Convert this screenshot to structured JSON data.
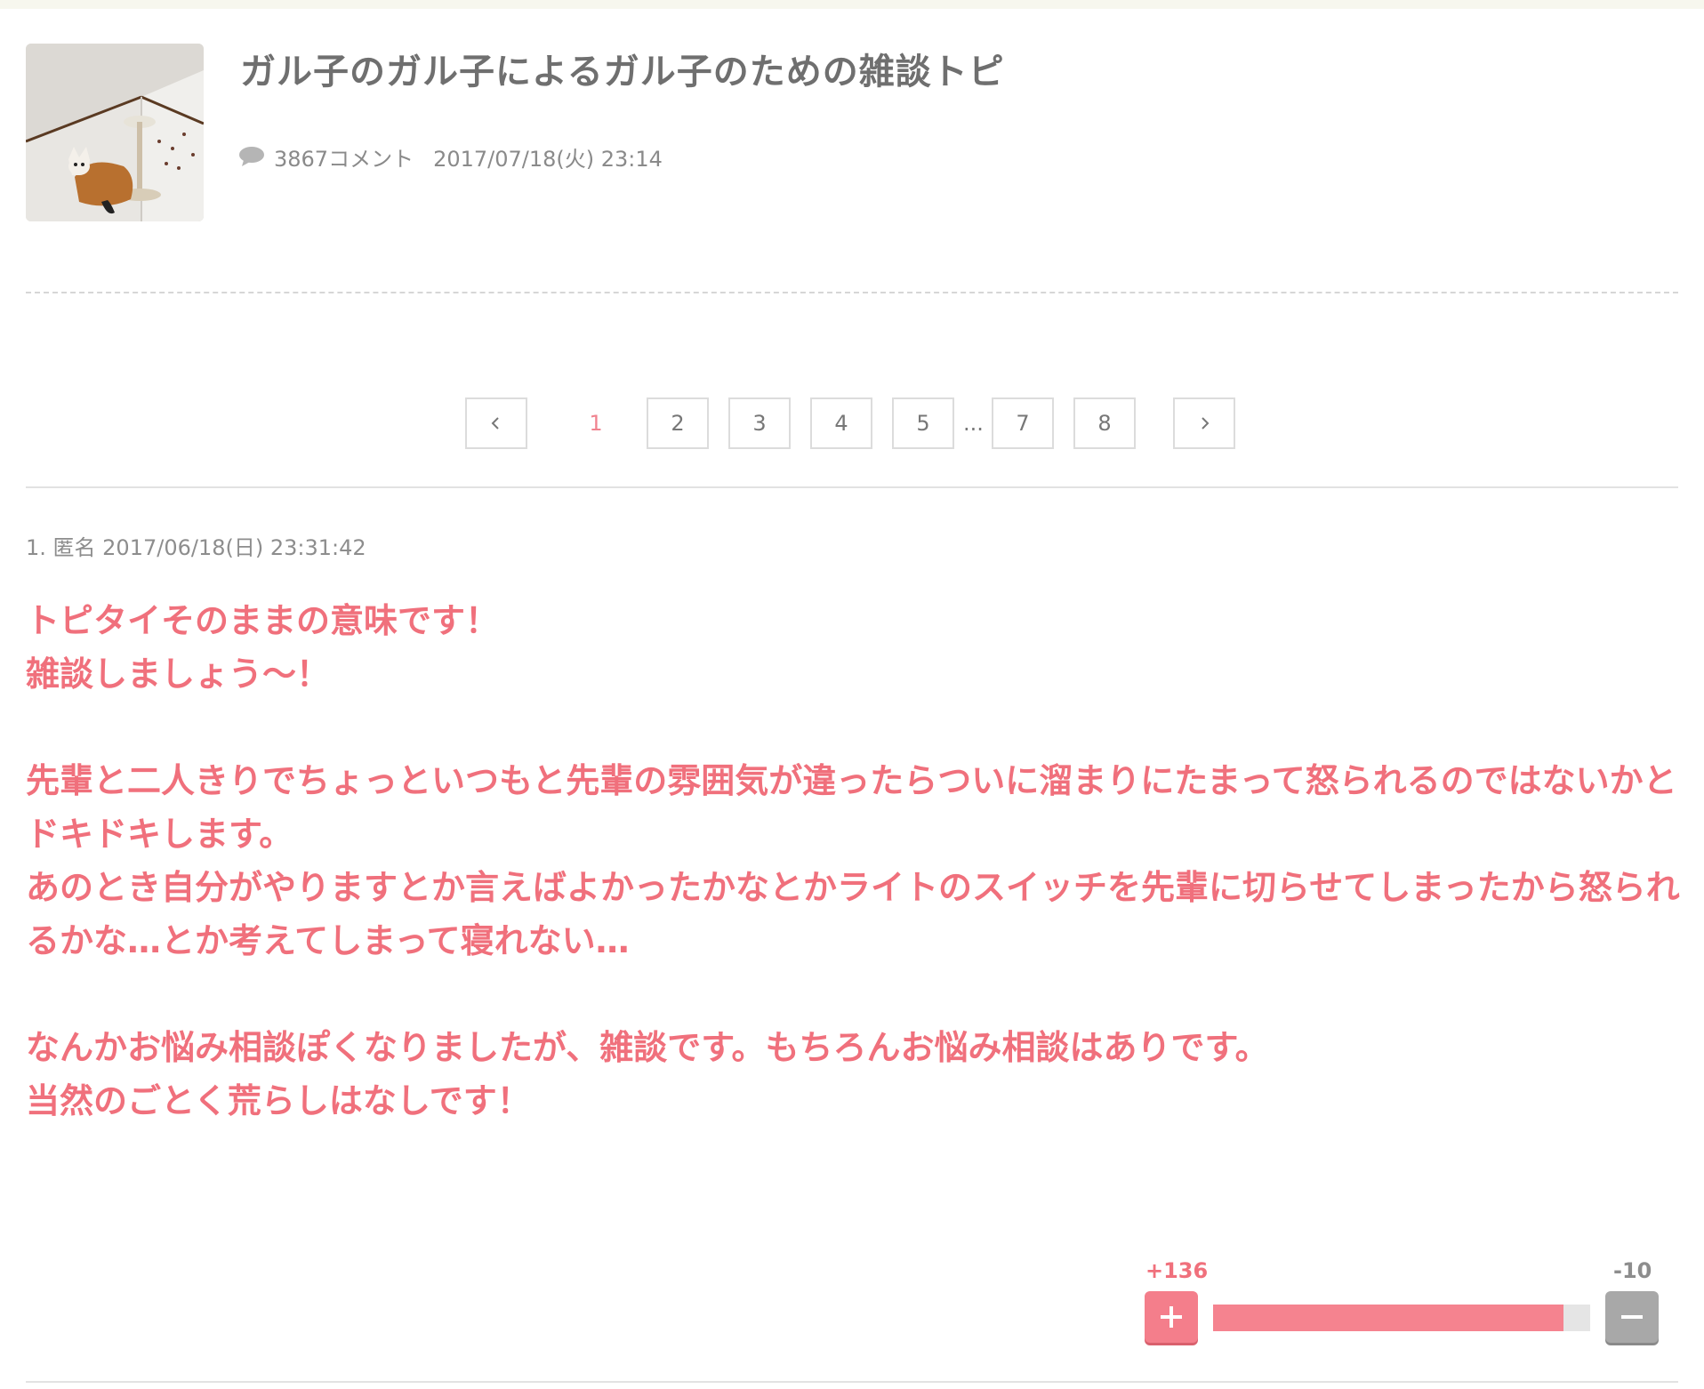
{
  "topic": {
    "title": "ガル子のガル子によるガル子のための雑談トピ",
    "comment_count": "3867コメント",
    "date": "2017/07/18(火) 23:14",
    "thumbnail_icon": "cat-photo-thumbnail"
  },
  "pagination": {
    "prev_icon": "chevron-left-icon",
    "next_icon": "chevron-right-icon",
    "current": "1",
    "pages": [
      "2",
      "3",
      "4",
      "5",
      "7",
      "8"
    ],
    "ellipsis": "..."
  },
  "comment": {
    "header": "1. 匿名 2017/06/18(日) 23:31:42",
    "paragraphs": [
      "トピタイそのままの意味です！\n雑談しましょう〜！",
      "先輩と二人きりでちょっといつもと先輩の雰囲気が違ったらついに溜まりにたまって怒られるのではないかとドキドキします。\nあのとき自分がやりますとか言えばよかったかなとかライトのスイッチを先輩に切らせてしまったから怒られるかな…とか考えてしまって寝れない…",
      "なんかお悩み相談ぽくなりましたが、雑談です。もちろんお悩み相談はありです。\n当然のごとく荒らしはなしです！"
    ],
    "votes": {
      "plus": "+136",
      "minus": "-10",
      "plus_fraction": 0.93
    }
  },
  "colors": {
    "accent": "#f0707c",
    "plus_button": "#f47e8b",
    "minus_button": "#a8a8a8"
  }
}
